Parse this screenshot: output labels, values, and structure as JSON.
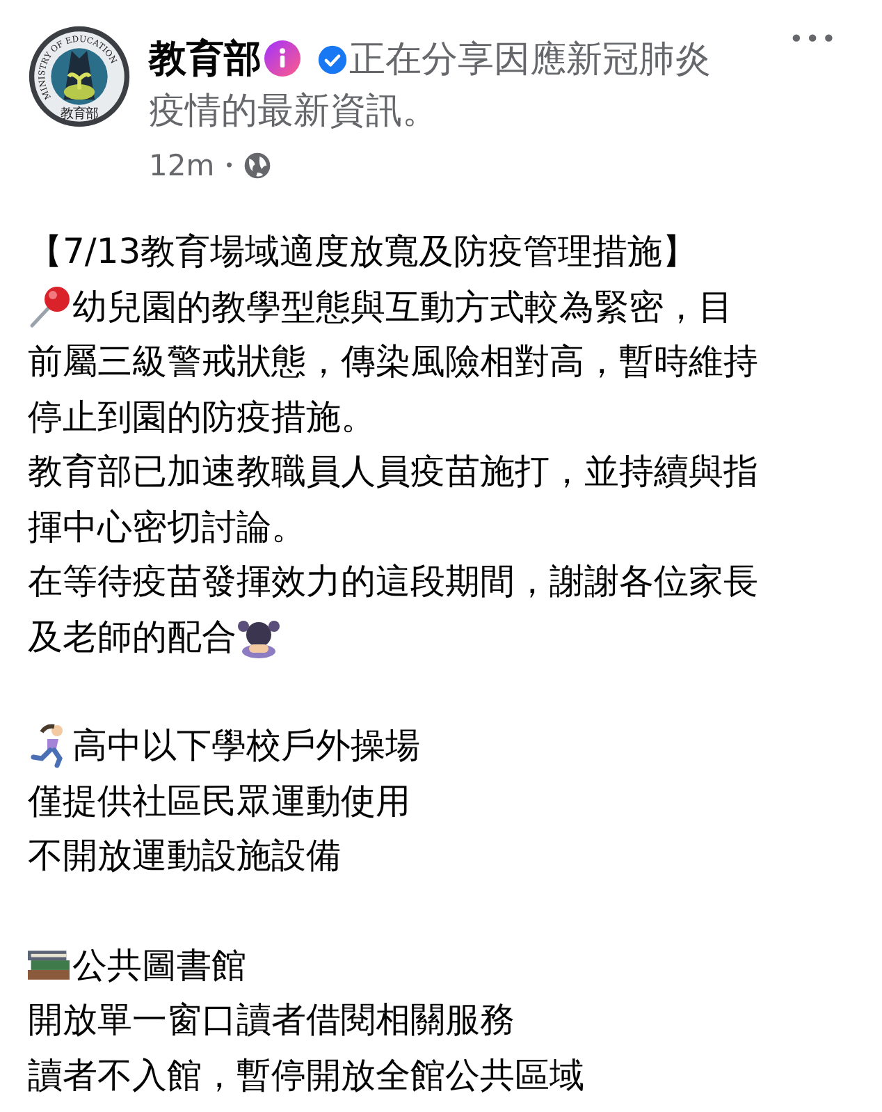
{
  "post": {
    "avatar": {
      "ring_text": "MINISTRY OF EDUCATION",
      "seal_text": "教育部"
    },
    "author": "教育部",
    "status_lines": [
      "正在分享因應新冠肺炎",
      "疫情的最新資訊。"
    ],
    "time": "12m",
    "separator": "•",
    "more": "•••",
    "sections": [
      {
        "lines": [
          {
            "text": "【7/13教育場域適度放寬及防疫管理措施】"
          },
          {
            "text": "幼兒園的教學型態與互動方式較為緊密，目",
            "kind": "pushpin"
          },
          {
            "text": "前屬三級警戒狀態，傳染風險相對高，暫時維持"
          },
          {
            "text": "停止到園的防疫措施。"
          },
          {
            "text": "教育部已加速教職員人員疫苗施打，並持續與指"
          },
          {
            "text": "揮中心密切討論。"
          },
          {
            "text": "在等待疫苗發揮效力的這段期間，謝謝各位家長"
          },
          {
            "text": "及老師的配合",
            "kind": "bowing"
          }
        ]
      },
      {
        "lines": [
          {
            "text": "高中以下學校戶外操場",
            "kind": "runner"
          },
          {
            "text": "僅提供社區民眾運動使用"
          },
          {
            "text": "不開放運動設施設備"
          }
        ]
      },
      {
        "lines": [
          {
            "text": "公共圖書館",
            "kind": "books"
          },
          {
            "text": "開放單一窗口讀者借閱相關服務"
          },
          {
            "text": "讀者不入館，暫停開放全館公共區域"
          }
        ]
      }
    ]
  }
}
